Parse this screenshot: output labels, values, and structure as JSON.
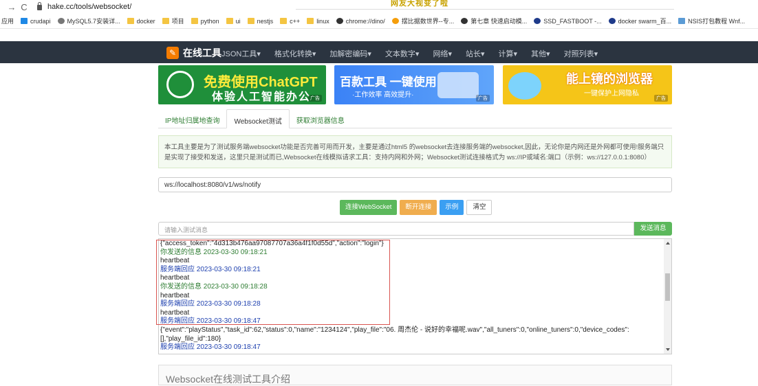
{
  "browser": {
    "url": "hake.cc/tools/websocket/",
    "banner_text": "网友大视变了啦",
    "bookmarks": [
      {
        "label": "应用",
        "icon": "none"
      },
      {
        "label": "crudapi",
        "icon": "blue"
      },
      {
        "label": "MySQL5.7安装详...",
        "icon": "globe"
      },
      {
        "label": "docker",
        "icon": "folder"
      },
      {
        "label": "项目",
        "icon": "folder"
      },
      {
        "label": "python",
        "icon": "folder"
      },
      {
        "label": "ui",
        "icon": "folder"
      },
      {
        "label": "nestjs",
        "icon": "folder"
      },
      {
        "label": "c++",
        "icon": "folder"
      },
      {
        "label": "linux",
        "icon": "folder"
      },
      {
        "label": "chrome://dino/",
        "icon": "dark"
      },
      {
        "label": "摆比据数世界--专...",
        "icon": "orange"
      },
      {
        "label": "第七章 快速启动模...",
        "icon": "dark"
      },
      {
        "label": "SSD_FASTBOOT -...",
        "icon": "navy"
      },
      {
        "label": "docker swarm_百...",
        "icon": "navy"
      },
      {
        "label": "NSIS打包教程 Wnf...",
        "icon": "plain"
      }
    ]
  },
  "site": {
    "logo": "在线工具",
    "nav": [
      "JSON工具▾",
      "格式化转换▾",
      "加解密编码▾",
      "文本数字▾",
      "网络▾",
      "站长▾",
      "计算▾",
      "其他▾",
      "对照列表▾"
    ]
  },
  "ads": {
    "a1_title": "免费使用ChatGPT",
    "a1_sub": "体验人工智能办公",
    "a2_title": "百款工具 一键使用",
    "a2_sub": "·工作效率 高效提升·",
    "a3_title": "能上镜的浏览器",
    "a3_sub": "一键保护上网隐私",
    "tag": "广告"
  },
  "tabs": [
    "IP地址归属地查询",
    "Websocket测试",
    "获取浏览器信息"
  ],
  "info": "本工具主要是为了测试服务端websocket功能是否完善可用而开发，主要是通过html5 的websocket去连接服务端的websocket,因此，无论你是内网还是外网都可使用!服务端只是实现了接受和发送，这里只是测试而已,Websocket在线模拟请求工具：支持内网和外网；Websocket测试连接格式为 ws://IP或域名:端口（示例：ws://127.0.0.1:8080）",
  "ws_url": "ws://localhost:8080/v1/ws/notify",
  "buttons": {
    "connect": "连接WebSocket",
    "disconnect": "断开连接",
    "example": "示例",
    "clear": "清空"
  },
  "message": {
    "placeholder": "请输入测试消息",
    "send": "发送消息"
  },
  "log": [
    {
      "type": "json",
      "text": "{\"access_token\":\"4d313b476aa97087707a36a4f1f0d55d\",\"action\":\"login\"}"
    },
    {
      "type": "sent",
      "text": "你发送的信息 2023-03-30 09:18:21"
    },
    {
      "type": "plain",
      "text": "heartbeat"
    },
    {
      "type": "recv",
      "text": "服务端回应 2023-03-30 09:18:21"
    },
    {
      "type": "plain",
      "text": "heartbeat"
    },
    {
      "type": "sent",
      "text": "你发送的信息 2023-03-30 09:18:28"
    },
    {
      "type": "plain",
      "text": "heartbeat"
    },
    {
      "type": "recv",
      "text": "服务端回应 2023-03-30 09:18:28"
    },
    {
      "type": "plain",
      "text": "heartbeat"
    },
    {
      "type": "recv",
      "text": "服务端回应 2023-03-30 09:18:47"
    },
    {
      "type": "wrap",
      "text": "{\"event\":\"playStatus\",\"task_id\":62,\"status\":0,\"name\":\"1234124\",\"play_file\":\"06. 周杰伦 - 说好的幸福呢.wav\",\"all_tuners\":0,\"online_tuners\":0,\"device_codes\":[],\"play_file_id\":180}"
    },
    {
      "type": "recv",
      "text": "服务端回应 2023-03-30 09:18:47"
    }
  ],
  "intro_title": "Websocket在线测试工具介绍"
}
